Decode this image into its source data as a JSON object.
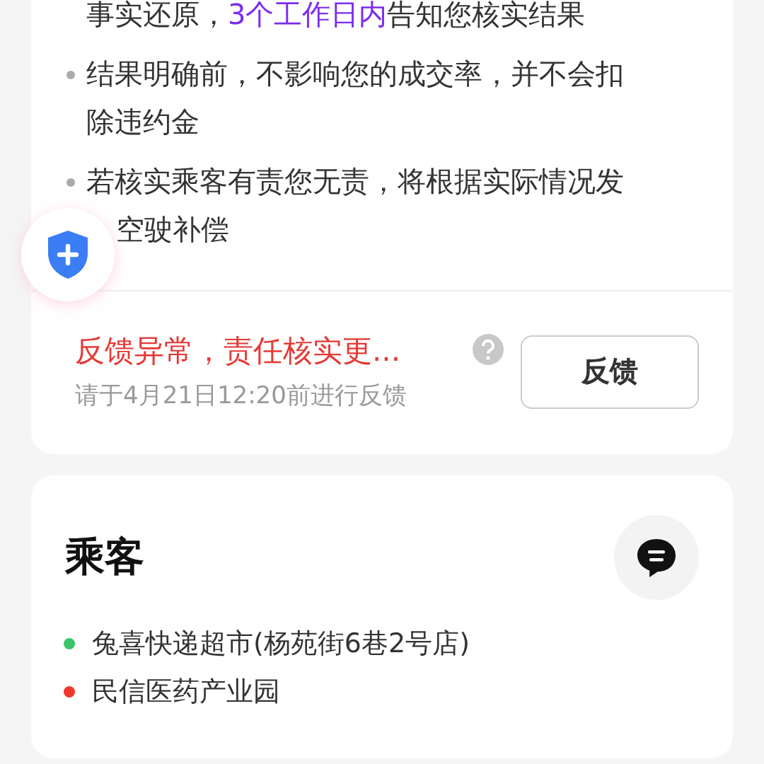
{
  "notice": {
    "items": [
      {
        "bullet": false,
        "lines": [
          [
            {
              "text": "事实还原，",
              "kind": "plain"
            },
            {
              "text": "3个工作日内",
              "kind": "highlight"
            },
            {
              "text": "告知您核实结果",
              "kind": "plain"
            }
          ]
        ]
      },
      {
        "bullet": true,
        "lines": [
          [
            {
              "text": "结果明确前，不影响您的成交率，并不会扣",
              "kind": "plain"
            }
          ],
          [
            {
              "text": "除违约金",
              "kind": "plain"
            }
          ]
        ]
      },
      {
        "bullet": true,
        "lines": [
          [
            {
              "text": "若核实乘客有责您无责，将根据实际情况发",
              "kind": "plain"
            }
          ],
          [
            {
              "text": "空驶补偿",
              "kind": "covered"
            }
          ]
        ]
      }
    ]
  },
  "feedback": {
    "title": "反馈异常，责任核实更...",
    "deadline": "请于4月21日12:20前进行反馈",
    "button": "反馈"
  },
  "passenger": {
    "title": "乘客",
    "stops": [
      {
        "name": "兔喜快递超市(杨苑街6巷2号店)",
        "color": "#3cc46a"
      },
      {
        "name": "民信医药产业园",
        "color": "#f0392b"
      }
    ]
  }
}
